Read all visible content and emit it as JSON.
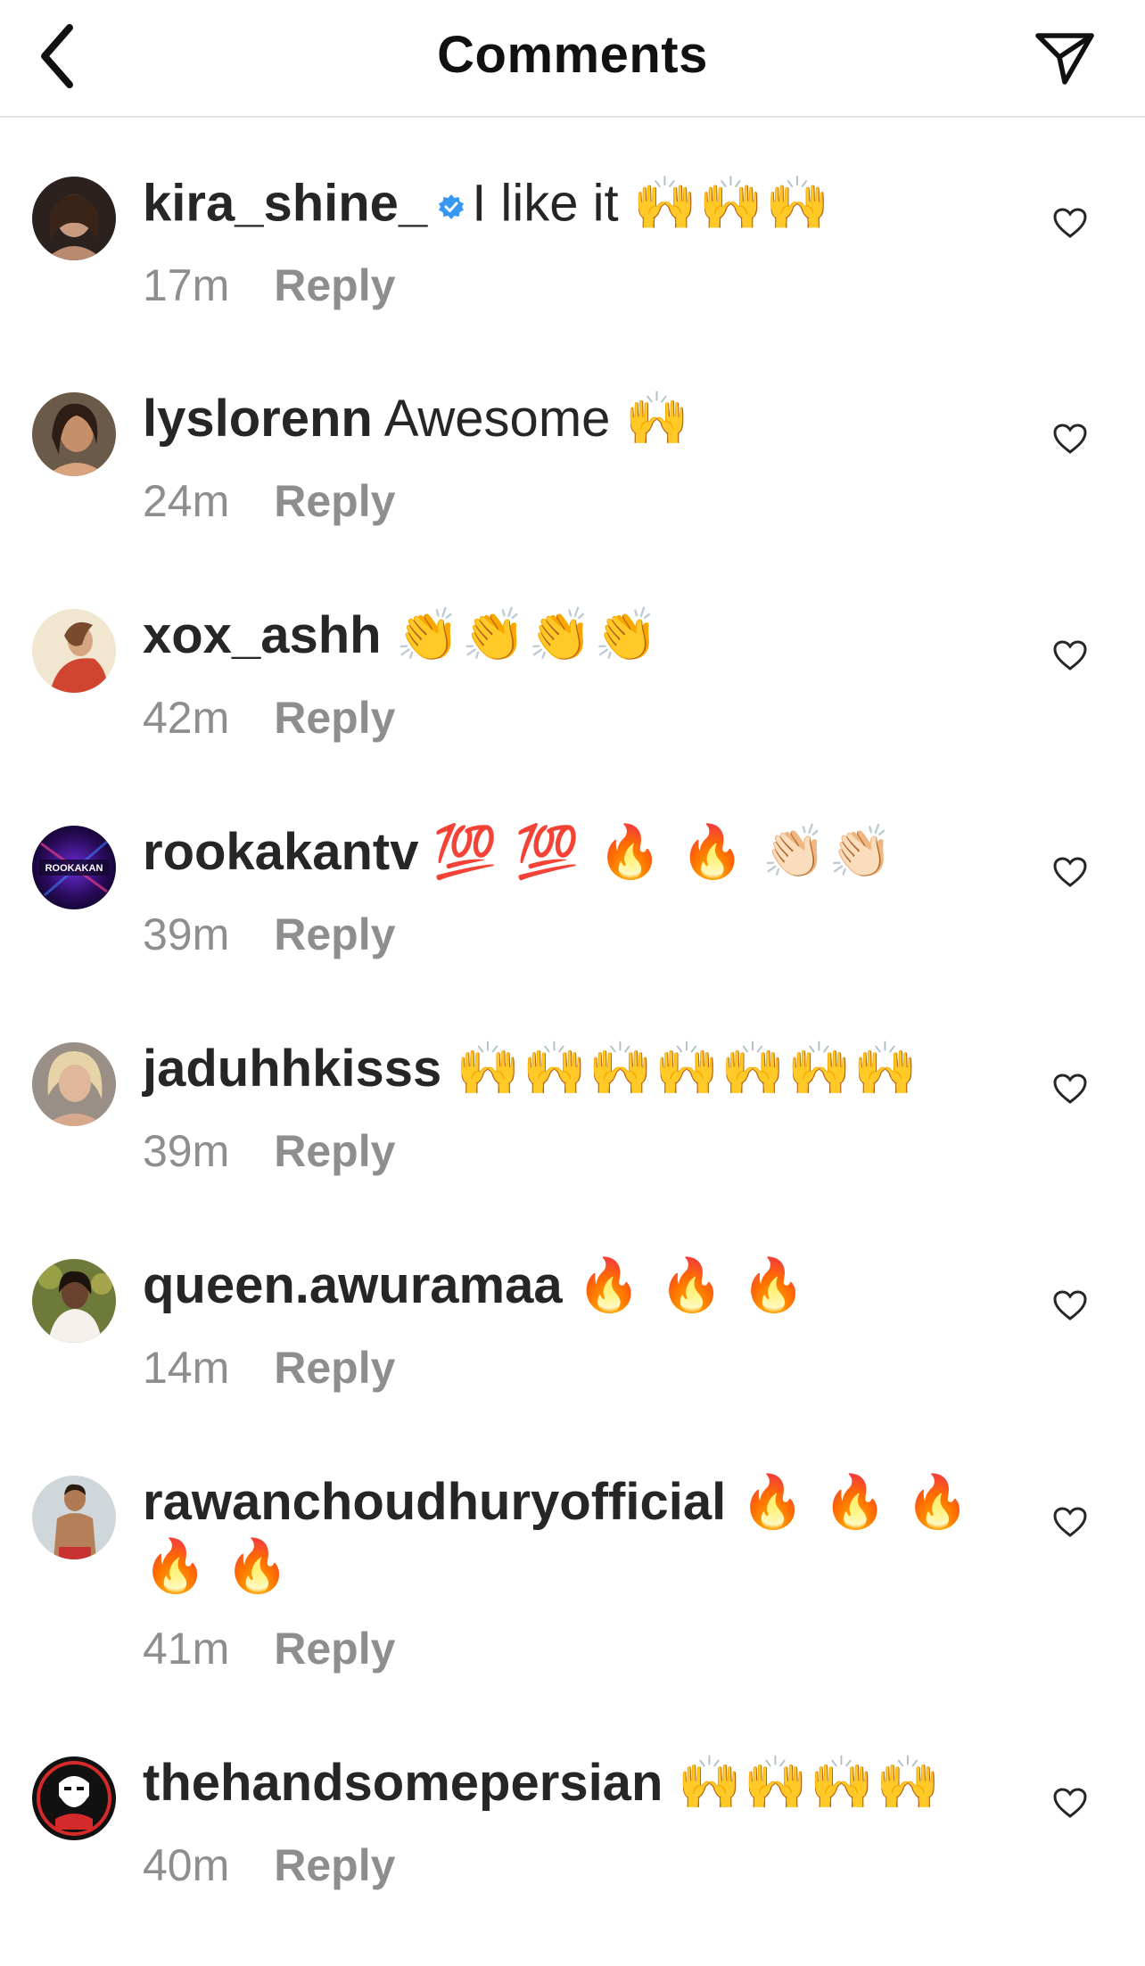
{
  "header": {
    "title": "Comments",
    "back_icon": "chevron-left-icon",
    "share_icon": "paper-plane-icon"
  },
  "colors": {
    "text": "#262626",
    "muted": "#8e8e8e",
    "verified": "#3897f0",
    "divider": "#e3e3e3"
  },
  "comments": [
    {
      "username": "kira_shine_",
      "verified": true,
      "text": "I like it",
      "emojis": "🙌🙌🙌",
      "time": "17m",
      "reply_label": "Reply"
    },
    {
      "username": "lyslorenn",
      "verified": false,
      "text": "Awesome",
      "emojis": "🙌",
      "time": "24m",
      "reply_label": "Reply"
    },
    {
      "username": "xox_ashh",
      "verified": false,
      "text": "",
      "emojis": "👏👏👏👏",
      "time": "42m",
      "reply_label": "Reply"
    },
    {
      "username": "rookakantv",
      "verified": false,
      "text": "",
      "emojis": "💯 💯 🔥 🔥 👏🏻👏🏻",
      "time": "39m",
      "reply_label": "Reply",
      "avatar_text": "ROOKAKAN"
    },
    {
      "username": "jaduhhkisss",
      "verified": false,
      "text": "",
      "emojis": "🙌🙌🙌🙌🙌🙌🙌",
      "time": "39m",
      "reply_label": "Reply"
    },
    {
      "username": "queen.awuramaa",
      "verified": false,
      "text": "",
      "emojis": "🔥 🔥 🔥",
      "time": "14m",
      "reply_label": "Reply"
    },
    {
      "username": "rawanchoudhuryofficial",
      "verified": false,
      "text": "",
      "emojis": "🔥 🔥 🔥 🔥 🔥",
      "time": "41m",
      "reply_label": "Reply"
    },
    {
      "username": "thehandsomepersian",
      "verified": false,
      "text": "",
      "emojis": "🙌🙌🙌🙌",
      "time": "40m",
      "reply_label": "Reply"
    }
  ]
}
